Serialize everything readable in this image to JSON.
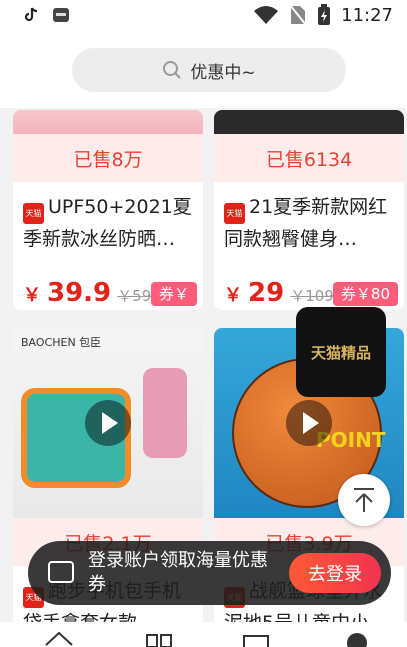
{
  "status_bar": {
    "time": "11:27",
    "icons": [
      "tiktok-icon",
      "app-icon",
      "wifi-icon",
      "no-sim-icon",
      "battery-charging-icon"
    ]
  },
  "search": {
    "placeholder": "优惠中~",
    "icon": "search-icon"
  },
  "products": [
    {
      "sold": "已售8万",
      "title": "UPF50+2021夏季新款冰丝防晒…",
      "price": "39.9",
      "old_price": "￥59.9",
      "coupon": "券￥"
    },
    {
      "sold": "已售6134",
      "title": "21夏季新款网红同款翘臀健身…",
      "price": "29",
      "old_price": "￥109",
      "coupon": "券￥80"
    },
    {
      "sold": "已售2.1万",
      "title": "跑步手机包手机袋手拿套女款…",
      "image_brand": "BAOCHEN 包臣"
    },
    {
      "sold": "已售3.9万",
      "title": "战舰篮球室外水泥地5号儿童中小…",
      "image_brand": "POINT"
    }
  ],
  "badge": {
    "text": "天猫精品"
  },
  "login_banner": {
    "text": "登录账户领取海量优惠券",
    "button": "去登录"
  },
  "currency_symbol": "￥",
  "tmall_tag": "天猫"
}
